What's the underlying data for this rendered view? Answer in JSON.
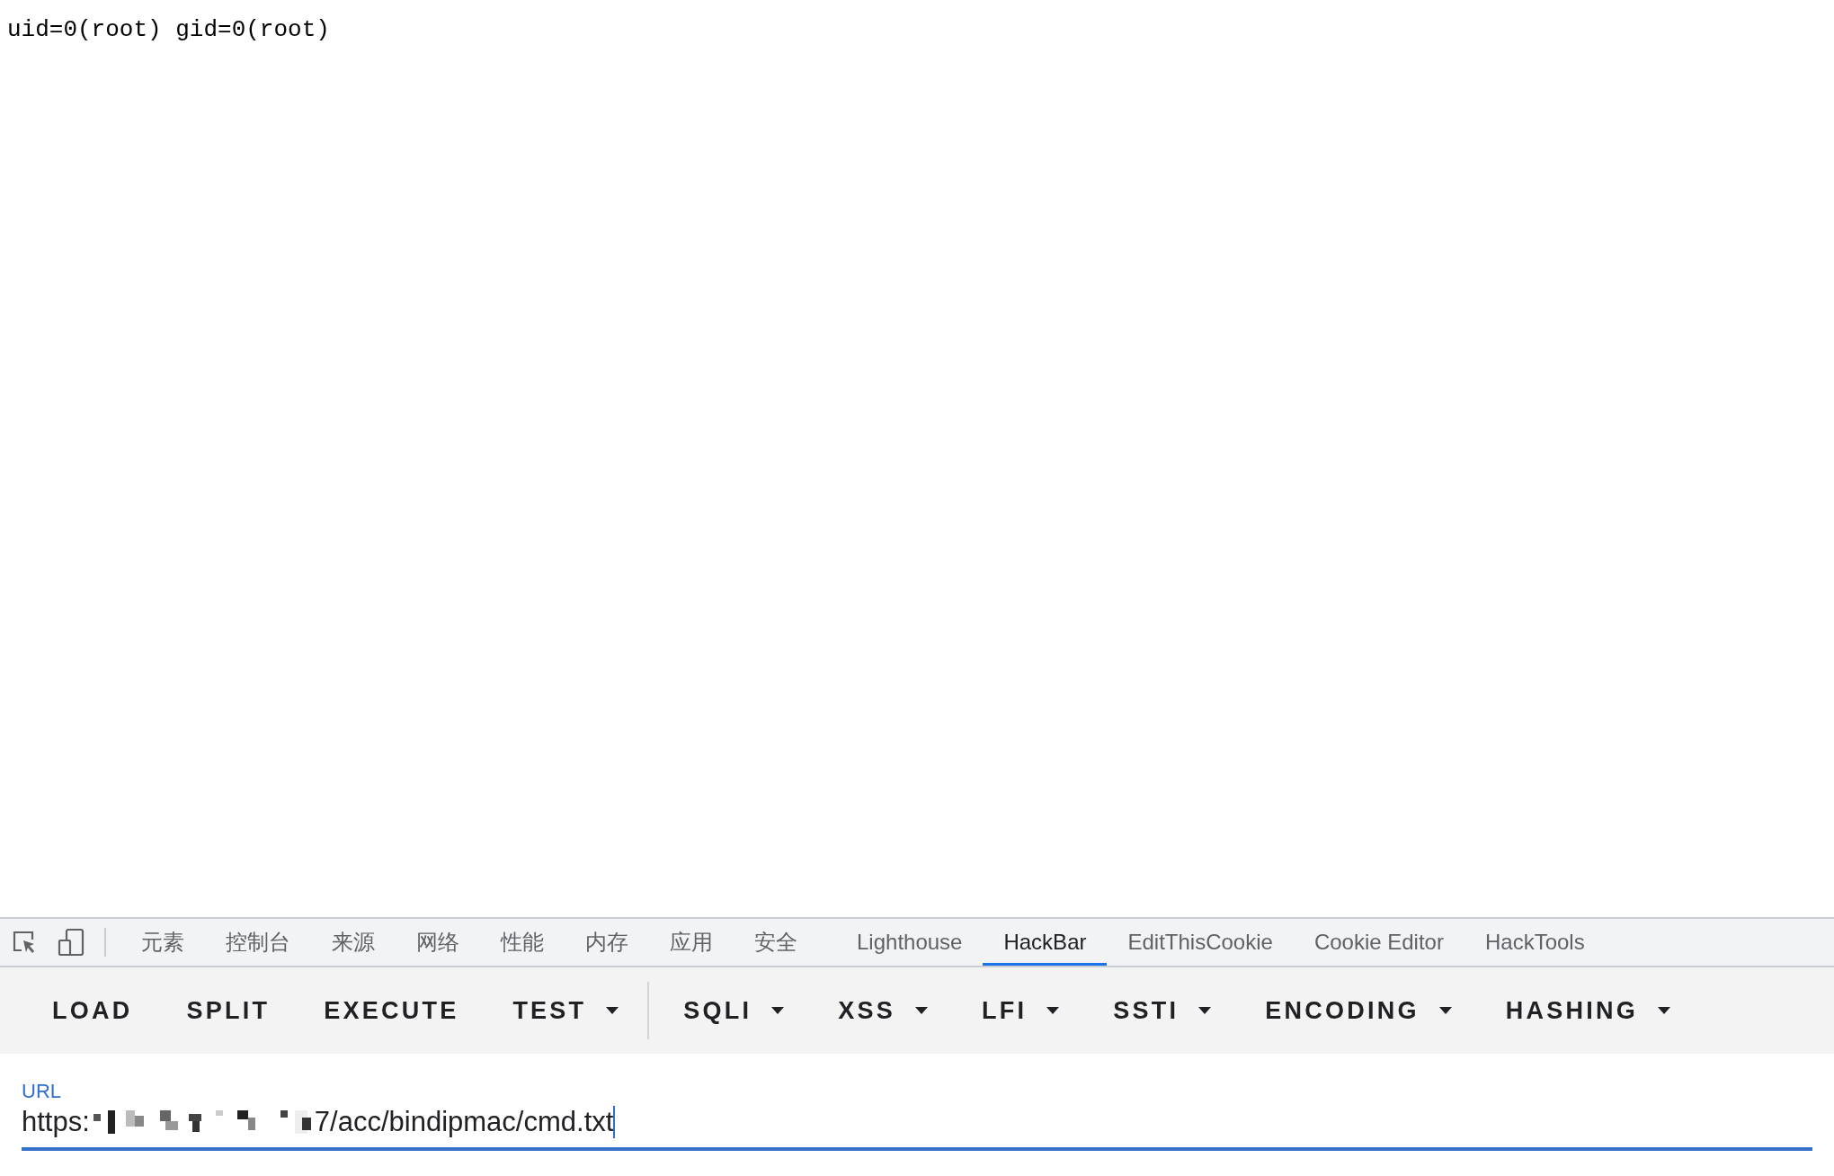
{
  "page": {
    "output": "uid=0(root) gid=0(root)"
  },
  "devtools_tabs": [
    {
      "label": "元素",
      "selected": false
    },
    {
      "label": "控制台",
      "selected": false
    },
    {
      "label": "来源",
      "selected": false
    },
    {
      "label": "网络",
      "selected": false
    },
    {
      "label": "性能",
      "selected": false
    },
    {
      "label": "内存",
      "selected": false
    },
    {
      "label": "应用",
      "selected": false
    },
    {
      "label": "安全",
      "selected": false
    },
    {
      "label": "Lighthouse",
      "selected": false
    },
    {
      "label": "HackBar",
      "selected": true
    },
    {
      "label": "EditThisCookie",
      "selected": false
    },
    {
      "label": "Cookie Editor",
      "selected": false
    },
    {
      "label": "HackTools",
      "selected": false
    }
  ],
  "hackbar_buttons": [
    {
      "label": "LOAD",
      "dropdown": false
    },
    {
      "label": "SPLIT",
      "dropdown": false
    },
    {
      "label": "EXECUTE",
      "dropdown": false
    },
    {
      "label": "TEST",
      "dropdown": true
    },
    {
      "label": "SQLI",
      "dropdown": true
    },
    {
      "label": "XSS",
      "dropdown": true
    },
    {
      "label": "LFI",
      "dropdown": true
    },
    {
      "label": "SSTI",
      "dropdown": true
    },
    {
      "label": "ENCODING",
      "dropdown": true
    },
    {
      "label": "HASHING",
      "dropdown": true
    }
  ],
  "url_field": {
    "label": "URL",
    "value_start": "https:",
    "redacted": true,
    "value_end": "7/acc/bindipmac/cmd.txt"
  }
}
